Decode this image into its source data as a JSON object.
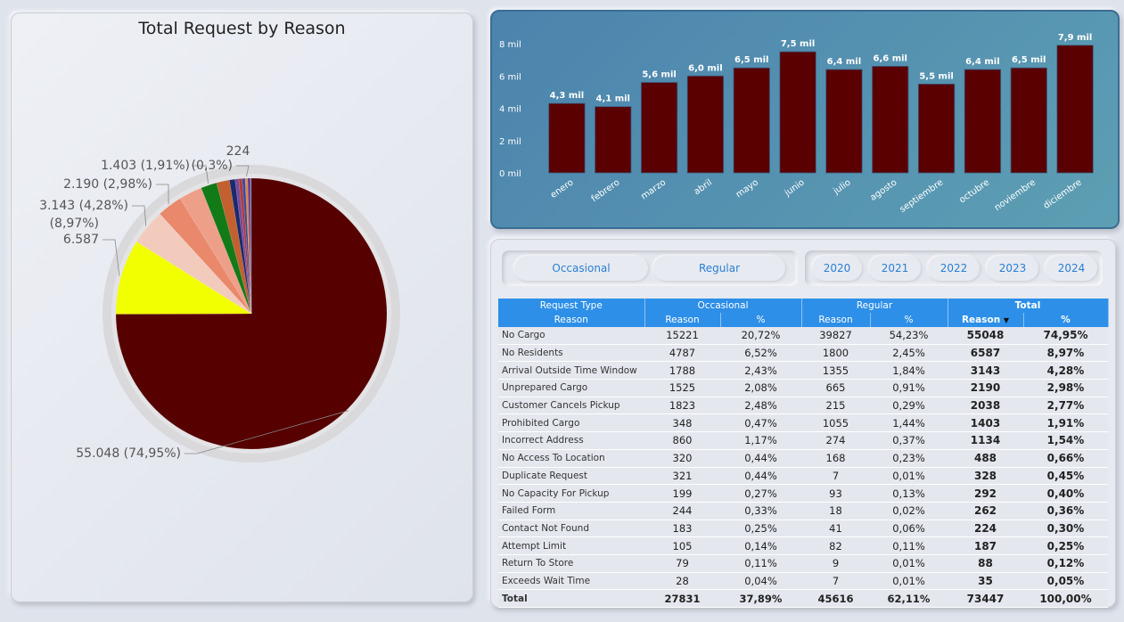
{
  "pie": {
    "title": "Total Request by Reason"
  },
  "chart_data": [
    {
      "type": "pie",
      "title": "Total Request by Reason",
      "slices": [
        {
          "label": "55.048 (74,95%)",
          "value": 55048,
          "color": "#560000"
        },
        {
          "label": "6.587 (8,97%)",
          "value": 6587,
          "color": "#f2ff00"
        },
        {
          "label": "3.143 (4,28%)",
          "value": 3143,
          "color": "#f2cbbd"
        },
        {
          "label": "2.190 (2,98%)",
          "value": 2190,
          "color": "#e9886a"
        },
        {
          "label": "",
          "value": 2038,
          "color": "#ee9f8a"
        },
        {
          "label": "1.403 (1,91%)",
          "value": 1403,
          "color": "#137a18"
        },
        {
          "label": "",
          "value": 1134,
          "color": "#c2602f"
        },
        {
          "label": "",
          "value": 488,
          "color": "#1a2a6e"
        },
        {
          "label": "",
          "value": 328,
          "color": "#7a4a9a"
        },
        {
          "label": "",
          "value": 292,
          "color": "#b13a3a"
        },
        {
          "label": "",
          "value": 262,
          "color": "#3a4aa0"
        },
        {
          "label": "224 (0,3%)",
          "value": 224,
          "color": "#d08a50"
        },
        {
          "label": "",
          "value": 187,
          "color": "#6a2a8a"
        },
        {
          "label": "",
          "value": 88,
          "color": "#2a6aa0"
        },
        {
          "label": "",
          "value": 35,
          "color": "#a05a8a"
        }
      ]
    },
    {
      "type": "bar",
      "categories": [
        "enero",
        "febrero",
        "marzo",
        "abril",
        "mayo",
        "junio",
        "julio",
        "agosto",
        "septiembre",
        "octubre",
        "noviembre",
        "diciembre"
      ],
      "values": [
        4300,
        4100,
        5600,
        6000,
        6500,
        7500,
        6400,
        6600,
        5500,
        6400,
        6500,
        7900
      ],
      "data_labels": [
        "4,3 mil",
        "4,1 mil",
        "5,6 mil",
        "6,0 mil",
        "6,5 mil",
        "7,5 mil",
        "6,4 mil",
        "6,6 mil",
        "5,5 mil",
        "6,4 mil",
        "6,5 mil",
        "7,9 mil"
      ],
      "y_ticks": [
        "0 mil",
        "2 mil",
        "4 mil",
        "6 mil",
        "8 mil"
      ],
      "y_tick_values": [
        0,
        2000,
        4000,
        6000,
        8000
      ],
      "ylim": [
        0,
        8000
      ],
      "bar_color": "#5a0000"
    }
  ],
  "slicers": {
    "type": [
      "Occasional",
      "Regular"
    ],
    "years": [
      "2020",
      "2021",
      "2022",
      "2023",
      "2024"
    ]
  },
  "table": {
    "group_headers": [
      "Request Type",
      "Occasional",
      "Regular",
      "Total"
    ],
    "sub_headers": [
      "Reason",
      "Reason",
      "%",
      "Reason",
      "%",
      "Reason",
      "%"
    ],
    "rows": [
      [
        "No Cargo",
        "15221",
        "20,72%",
        "39827",
        "54,23%",
        "55048",
        "74,95%"
      ],
      [
        "No Residents",
        "4787",
        "6,52%",
        "1800",
        "2,45%",
        "6587",
        "8,97%"
      ],
      [
        "Arrival Outside Time Window",
        "1788",
        "2,43%",
        "1355",
        "1,84%",
        "3143",
        "4,28%"
      ],
      [
        "Unprepared Cargo",
        "1525",
        "2,08%",
        "665",
        "0,91%",
        "2190",
        "2,98%"
      ],
      [
        "Customer Cancels Pickup",
        "1823",
        "2,48%",
        "215",
        "0,29%",
        "2038",
        "2,77%"
      ],
      [
        "Prohibited Cargo",
        "348",
        "0,47%",
        "1055",
        "1,44%",
        "1403",
        "1,91%"
      ],
      [
        "Incorrect Address",
        "860",
        "1,17%",
        "274",
        "0,37%",
        "1134",
        "1,54%"
      ],
      [
        "No Access To Location",
        "320",
        "0,44%",
        "168",
        "0,23%",
        "488",
        "0,66%"
      ],
      [
        "Duplicate Request",
        "321",
        "0,44%",
        "7",
        "0,01%",
        "328",
        "0,45%"
      ],
      [
        "No Capacity For Pickup",
        "199",
        "0,27%",
        "93",
        "0,13%",
        "292",
        "0,40%"
      ],
      [
        "Failed Form",
        "244",
        "0,33%",
        "18",
        "0,02%",
        "262",
        "0,36%"
      ],
      [
        "Contact Not Found",
        "183",
        "0,25%",
        "41",
        "0,06%",
        "224",
        "0,30%"
      ],
      [
        "Attempt Limit",
        "105",
        "0,14%",
        "82",
        "0,11%",
        "187",
        "0,25%"
      ],
      [
        "Return To Store",
        "79",
        "0,11%",
        "9",
        "0,01%",
        "88",
        "0,12%"
      ],
      [
        "Exceeds Wait Time",
        "28",
        "0,04%",
        "7",
        "0,01%",
        "35",
        "0,05%"
      ]
    ],
    "total_row": [
      "Total",
      "27831",
      "37,89%",
      "45616",
      "62,11%",
      "73447",
      "100,00%"
    ],
    "sort_icon": "sort-desc-icon"
  }
}
